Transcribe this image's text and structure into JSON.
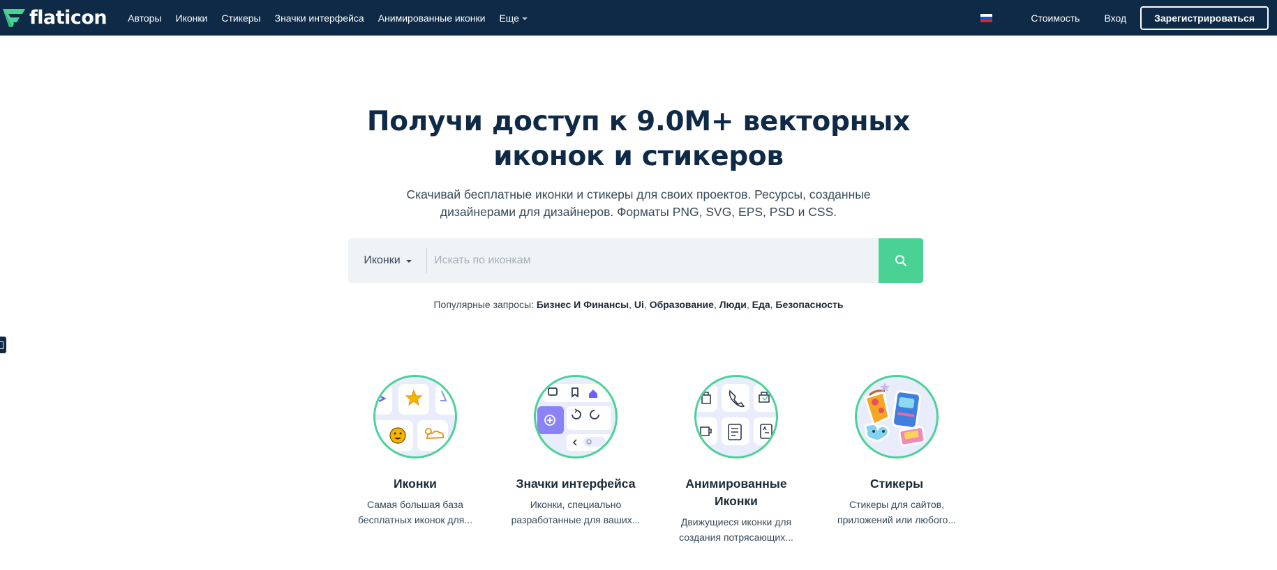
{
  "brand": {
    "name": "flaticon",
    "color_green": "#4ad295",
    "color_navy": "#0e2a47"
  },
  "nav": {
    "items": [
      {
        "label": "Авторы"
      },
      {
        "label": "Иконки"
      },
      {
        "label": "Стикеры"
      },
      {
        "label": "Значки интерфейса"
      },
      {
        "label": "Анимированные иконки"
      },
      {
        "label": "Еще"
      }
    ],
    "pricing": "Стоимость",
    "login": "Вход",
    "signup": "Зарегистрироваться",
    "language_icon": "russia-flag-icon"
  },
  "hero": {
    "title_line1": "Получи доступ к 9.0M+ векторных",
    "title_line2": "иконок и стикеров",
    "subtitle_line1": "Скачивай бесплатные иконки и стикеры для своих проектов. Ресурсы, созданные",
    "subtitle_line2": "дизайнерами для дизайнеров. Форматы PNG, SVG, EPS, PSD и CSS."
  },
  "search": {
    "type_value": "Иконки",
    "placeholder": "Искать по иконкам",
    "value": "",
    "button_icon": "search-icon"
  },
  "popular": {
    "label": "Популярные запросы:",
    "tags": [
      "Бизнес И Финансы",
      "Ui",
      "Образование",
      "Люди",
      "Еда",
      "Безопасность"
    ]
  },
  "categories": [
    {
      "title_line1": "Иконки",
      "title_line2": "",
      "desc_line1": "Самая большая база",
      "desc_line2": "бесплатных иконок для..."
    },
    {
      "title_line1": "Значки интерфейса",
      "title_line2": "",
      "desc_line1": "Иконки, специально",
      "desc_line2": "разработанные для ваших..."
    },
    {
      "title_line1": "Анимированные",
      "title_line2": "Иконки",
      "desc_line1": "Движущиеся иконки для",
      "desc_line2": "создания потрясающих..."
    },
    {
      "title_line1": "Стикеры",
      "title_line2": "",
      "desc_line1": "Стикеры для сайтов,",
      "desc_line2": "приложений или любого..."
    }
  ]
}
